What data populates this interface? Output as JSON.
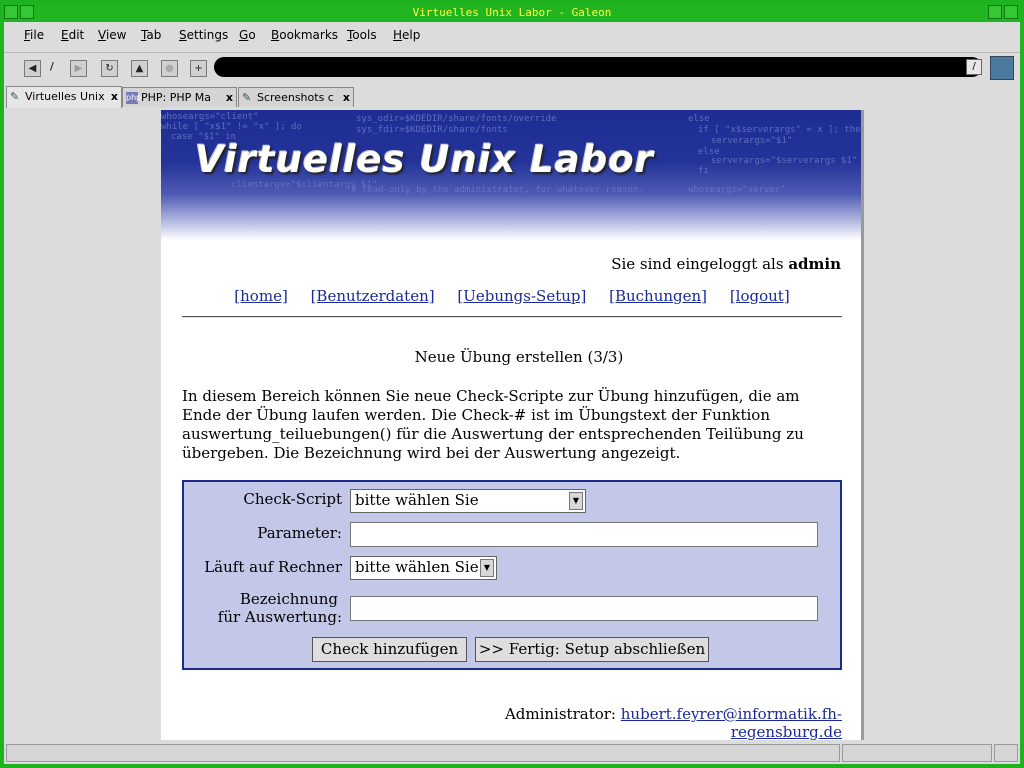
{
  "window": {
    "title": "Virtuelles Unix Labor - Galeon"
  },
  "menubar": [
    {
      "label": "File",
      "u": "F",
      "rest": "ile"
    },
    {
      "label": "Edit",
      "u": "E",
      "rest": "dit"
    },
    {
      "label": "View",
      "u": "V",
      "rest": "iew"
    },
    {
      "label": "Tab",
      "u": "T",
      "rest": "ab"
    },
    {
      "label": "Settings",
      "u": "S",
      "rest": "ettings"
    },
    {
      "label": "Go",
      "u": "G",
      "rest": "o"
    },
    {
      "label": "Bookmarks",
      "u": "B",
      "rest": "ookmarks"
    },
    {
      "label": "Tools",
      "u": "T",
      "rest": "ools"
    },
    {
      "label": "Help",
      "u": "H",
      "rest": "elp"
    }
  ],
  "toolbar": {
    "url": ""
  },
  "tabs": [
    {
      "label": "Virtuelles Unix",
      "close": "x"
    },
    {
      "label": "PHP: PHP Ma",
      "close": "x",
      "icon_text": "php"
    },
    {
      "label": "Screenshots c",
      "close": "x"
    }
  ],
  "banner": {
    "title": "Virtuelles Unix Labor",
    "code_lines": [
      "whoseargs=\"client\"",
      "while [ \"x$1\" != \"x\" ]; do",
      "  case \"$1\" in",
      "sys_odir=$KDEDIR/share/fonts/override",
      "sys_fdir=$KDEDIR/share/fonts",
      "else",
      "  if [ \"x$serverargs\" = x ]; then",
      "     serverargs=\"$1\"",
      "  else",
      "     serverargs=\"$serverargs $1\"",
      "  fi",
      "whoseargs=\"server\"",
      "# read-only by the administrator, for whatever reason.",
      "clientargs=\"$clientargs $1\""
    ]
  },
  "page": {
    "login_text": "Sie sind eingeloggt als",
    "login_user": "admin",
    "nav": [
      "[home]",
      "[Benutzerdaten]",
      "[Uebungs-Setup]",
      "[Buchungen]",
      "[logout]"
    ],
    "step_title": "Neue Übung erstellen (3/3)",
    "intro": "In diesem Bereich können Sie neue Check-Scripte zur Übung hinzufügen, die am Ende der Übung laufen werden. Die Check-# ist im Übungstext der Funktion auswertung_teiluebungen() für die Auswertung der entsprechenden Teilübung zu übergeben. Die Bezeichnung wird bei der Auswertung angezeigt.",
    "form": {
      "check_script_label": "Check-Script",
      "check_script_value": "bitte wählen Sie",
      "parameter_label": "Parameter:",
      "parameter_value": "",
      "rechner_label": "Läuft auf Rechner",
      "rechner_value": "bitte wählen Sie",
      "bezeichnung_label_1": "Bezeichnung",
      "bezeichnung_label_2": "für Auswertung:",
      "bezeichnung_value": "",
      "add_button": "Check hinzufügen",
      "finish_button": ">> Fertig: Setup abschließen"
    },
    "admin_label": "Administrator:",
    "admin_email": "hubert.feyrer@informatik.fh-regensburg.de"
  },
  "statusbar": {
    "text": ""
  }
}
